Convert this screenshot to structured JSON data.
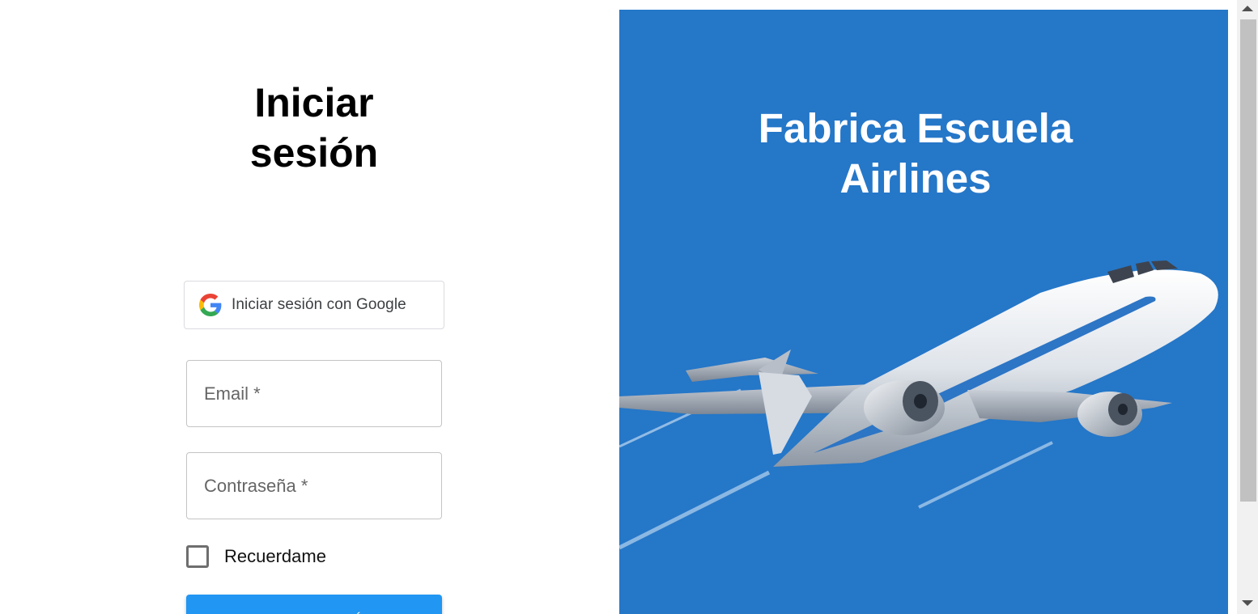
{
  "login": {
    "title_line1": "Iniciar",
    "title_line2": "sesión",
    "google_button_label": "Iniciar sesión con Google",
    "email_label": "Email *",
    "password_label": "Contraseña *",
    "remember_label": "Recuerdame",
    "submit_label": "INICIAR SESIÓN"
  },
  "hero": {
    "title_line1": "Fabrica Escuela",
    "title_line2": "Airlines"
  },
  "colors": {
    "hero_bg": "#2577c8",
    "primary_button": "#2196f3",
    "google_blue": "#4285F4",
    "google_red": "#EA4335",
    "google_yellow": "#FBBC05",
    "google_green": "#34A853"
  },
  "icons": {
    "google": "google-g-icon",
    "scroll_up": "chevron-up-icon",
    "scroll_down": "chevron-down-icon"
  }
}
